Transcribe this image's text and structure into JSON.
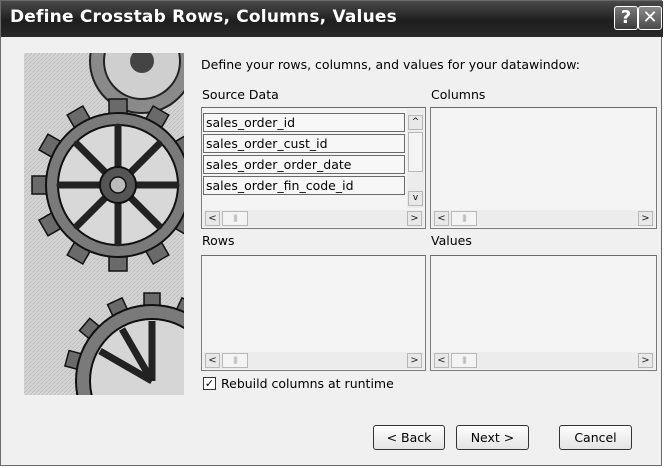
{
  "window": {
    "title": "Define Crosstab Rows, Columns, Values",
    "help_label": "?",
    "close_label": "✕"
  },
  "instructions": "Define your rows, columns, and values for your datawindow:",
  "source_data": {
    "label": "Source Data",
    "items": [
      "sales_order_id",
      "sales_order_cust_id",
      "sales_order_order_date",
      "sales_order_fin_code_id"
    ]
  },
  "columns": {
    "label": "Columns"
  },
  "rows": {
    "label": "Rows"
  },
  "values": {
    "label": "Values"
  },
  "rebuild_checkbox": {
    "label": "Rebuild columns at runtime",
    "checked": true,
    "mark": "✓"
  },
  "buttons": {
    "back": "< Back",
    "next": "Next >",
    "cancel": "Cancel"
  },
  "scroll": {
    "left": "<",
    "right": ">",
    "up": "^",
    "down": "v",
    "grip": "|||"
  },
  "icons": [
    "help-icon",
    "close-icon",
    "gear-illustration",
    "scroll-left-icon",
    "scroll-right-icon",
    "scroll-up-icon",
    "scroll-down-icon"
  ]
}
